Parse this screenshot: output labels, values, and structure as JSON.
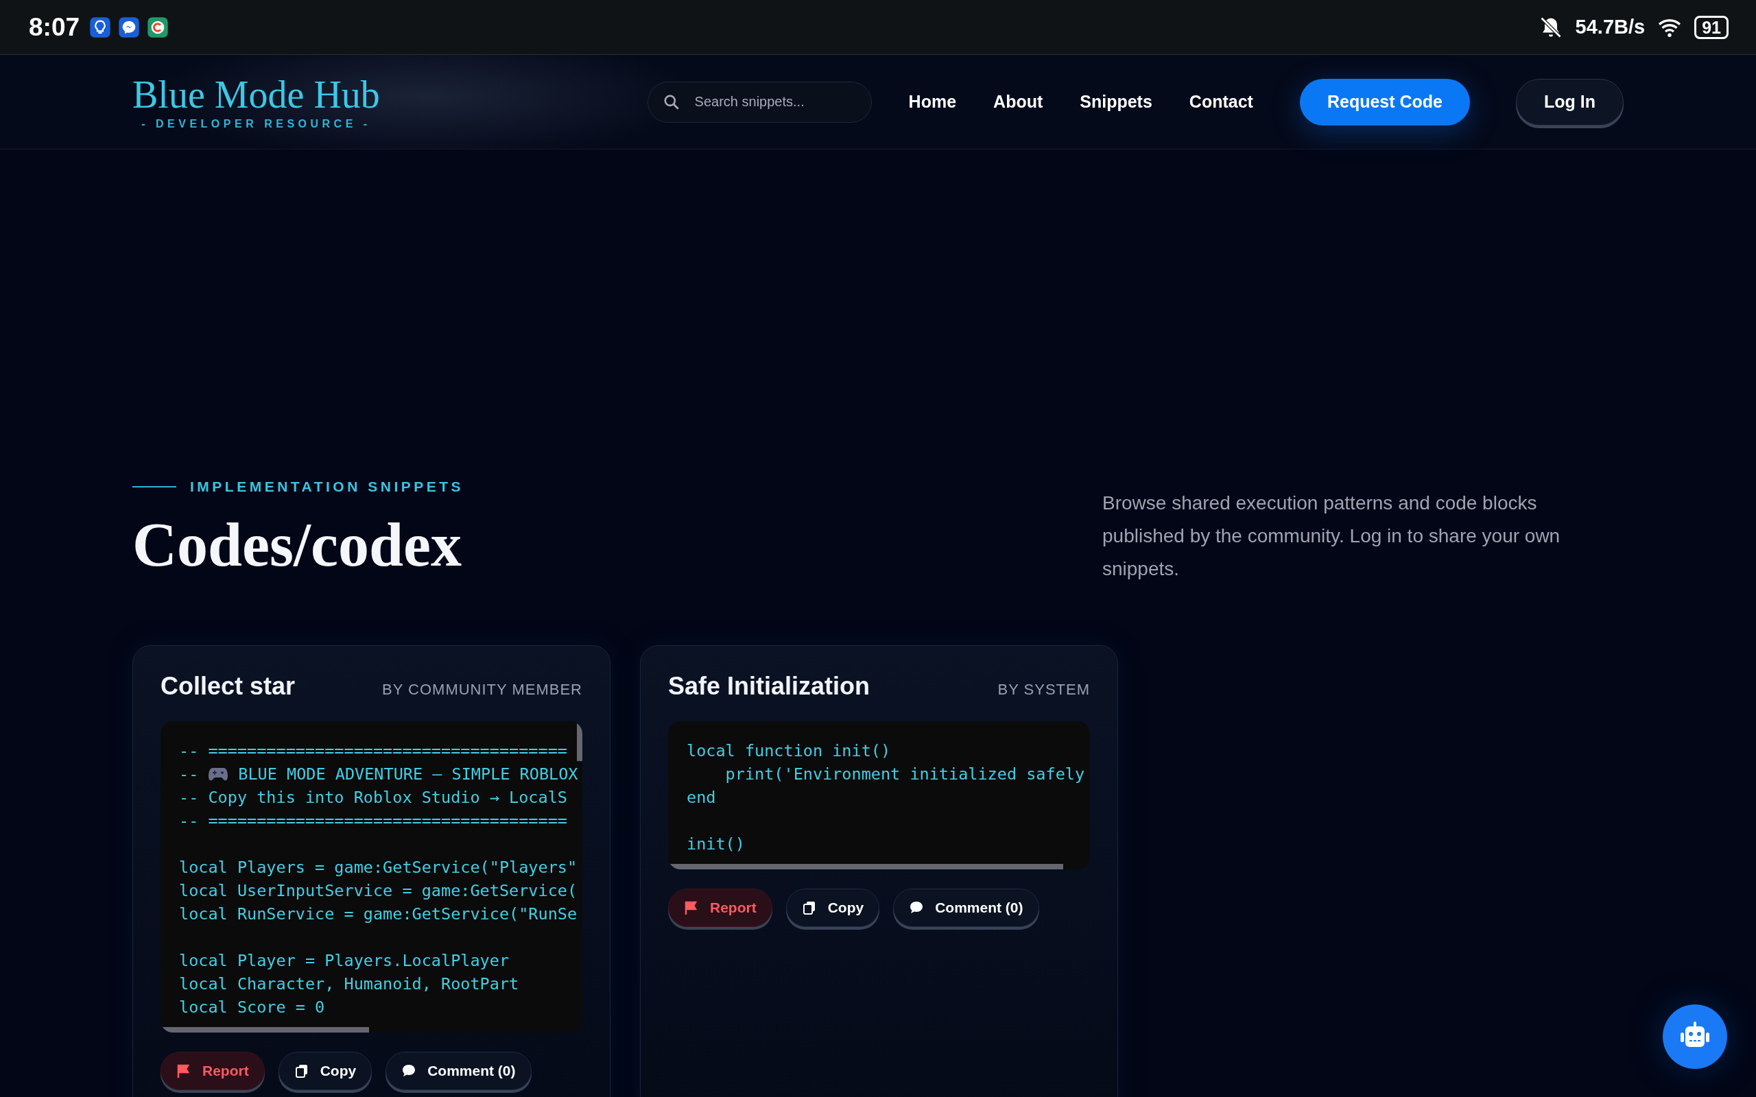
{
  "status_bar": {
    "time": "8:07",
    "app_icons": [
      {
        "kind": "bulb",
        "color": "#1a5fd8"
      },
      {
        "kind": "messenger",
        "color": "#1a5fd8"
      },
      {
        "kind": "c",
        "color": "#1f9a6a"
      }
    ],
    "speed": "54.7B/s",
    "battery": "91"
  },
  "header": {
    "logo": "Blue Mode Hub",
    "tagline": "- DEVELOPER RESOURCE -",
    "search": {
      "placeholder": "Search snippets..."
    },
    "nav": [
      "Home",
      "About",
      "Snippets",
      "Contact"
    ],
    "buttons": [
      {
        "kind": "primary",
        "label": "Request Code"
      },
      {
        "kind": "outline",
        "label": "Log In"
      }
    ]
  },
  "intro": {
    "eyebrow": "IMPLEMENTATION SNIPPETS",
    "title": "Codes/codex",
    "description": "Browse shared execution patterns and code blocks published by the community. Log in to share your own snippets."
  },
  "snippets": [
    {
      "title": "Collect star",
      "author": "BY COMMUNITY MEMBER",
      "lines": [
        {
          "kind": "code",
          "text": "-- ====================================="
        },
        {
          "kind": "icon",
          "prefix": "--",
          "text": "BLUE MODE ADVENTURE — SIMPLE ROBLOX"
        },
        {
          "kind": "code",
          "text": "-- Copy this into Roblox Studio → LocalS"
        },
        {
          "kind": "code",
          "text": "-- ====================================="
        },
        {
          "kind": "blank"
        },
        {
          "kind": "code",
          "text": "local Players = game:GetService(\"Players\""
        },
        {
          "kind": "code",
          "text": "local UserInputService = game:GetService("
        },
        {
          "kind": "code",
          "text": "local RunService = game:GetService(\"RunSe"
        },
        {
          "kind": "blank"
        },
        {
          "kind": "code",
          "text": "local Player = Players.LocalPlayer"
        },
        {
          "kind": "code",
          "text": "local Character, Humanoid, RootPart"
        },
        {
          "kind": "code",
          "text": "local Score = 0"
        }
      ],
      "actions": [
        {
          "kind": "report",
          "label": "Report"
        },
        {
          "kind": "copy",
          "label": "Copy"
        },
        {
          "kind": "comment",
          "label": "Comment (0)"
        }
      ]
    },
    {
      "title": "Safe Initialization",
      "author": "BY SYSTEM",
      "lines": [
        {
          "kind": "code",
          "text": "local function init()"
        },
        {
          "kind": "code",
          "text": "    print('Environment initialized safely"
        },
        {
          "kind": "code",
          "text": "end"
        },
        {
          "kind": "blank"
        },
        {
          "kind": "code",
          "text": "init()"
        }
      ],
      "actions": [
        {
          "kind": "report",
          "label": "Report"
        },
        {
          "kind": "copy",
          "label": "Copy"
        },
        {
          "kind": "comment",
          "label": "Comment (0)"
        }
      ]
    }
  ]
}
